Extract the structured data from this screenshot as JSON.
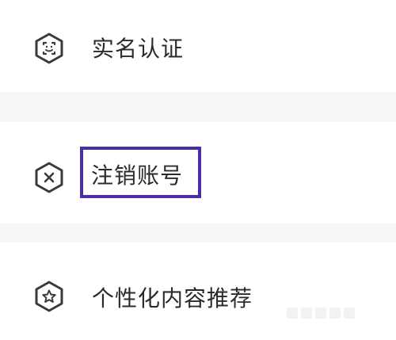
{
  "settings_menu": {
    "items": [
      {
        "label": "实名认证",
        "icon": "face-scan-icon"
      },
      {
        "label": "注销账号",
        "icon": "close-circle-icon",
        "highlighted": true
      },
      {
        "label": "个性化内容推荐",
        "icon": "star-icon"
      }
    ]
  },
  "colors": {
    "highlight_border": "#4b2ea7",
    "icon_stroke": "#3a3a3a",
    "text": "#2b2b2b",
    "row_background": "#ffffff",
    "divider_background": "#f6f6f6"
  }
}
